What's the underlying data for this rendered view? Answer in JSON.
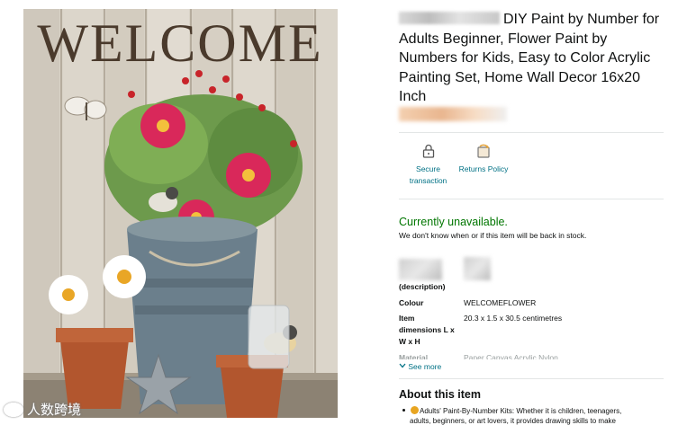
{
  "product_image": {
    "sign_text": "WELCOME",
    "watermark_text": "人数跨境"
  },
  "title": {
    "brand_blurred": true,
    "text": "DIY Paint by Number for Adults Beginner, Flower Paint by Numbers for Kids, Easy to Color Acrylic Painting Set, Home Wall Decor 16x20 Inch"
  },
  "features": [
    {
      "icon": "lock-icon",
      "label_lines": [
        "Secure",
        "transaction"
      ]
    },
    {
      "icon": "return-box-icon",
      "label_lines": [
        "Returns Policy"
      ]
    }
  ],
  "availability": {
    "status": "Currently unavailable.",
    "note": "We don't know when or if this item will be back in stock."
  },
  "specs": {
    "first_label": "(description)",
    "rows": [
      {
        "label_lines": [
          "Colour"
        ],
        "value": "WELCOMEFLOWER"
      },
      {
        "label_lines": [
          "Item",
          "dimensions L x",
          "W x H"
        ],
        "value": "20.3 x 1.5 x 30.5 centimetres"
      },
      {
        "label_lines": [
          "Material"
        ],
        "value": "Paper Canvas Acrylic Nylon"
      }
    ],
    "see_more": "See more"
  },
  "about": {
    "title": "About this item",
    "bullet_1": "Adults' Paint-By-Number Kits: Whether it is children, teenagers,",
    "bullet_1_cut": "adults, beginners, or art lovers, it provides drawing skills to make"
  },
  "colors": {
    "link": "#007185",
    "in_stock_green": "#007600",
    "text": "#0f1111",
    "divider": "#e3e6e6"
  }
}
